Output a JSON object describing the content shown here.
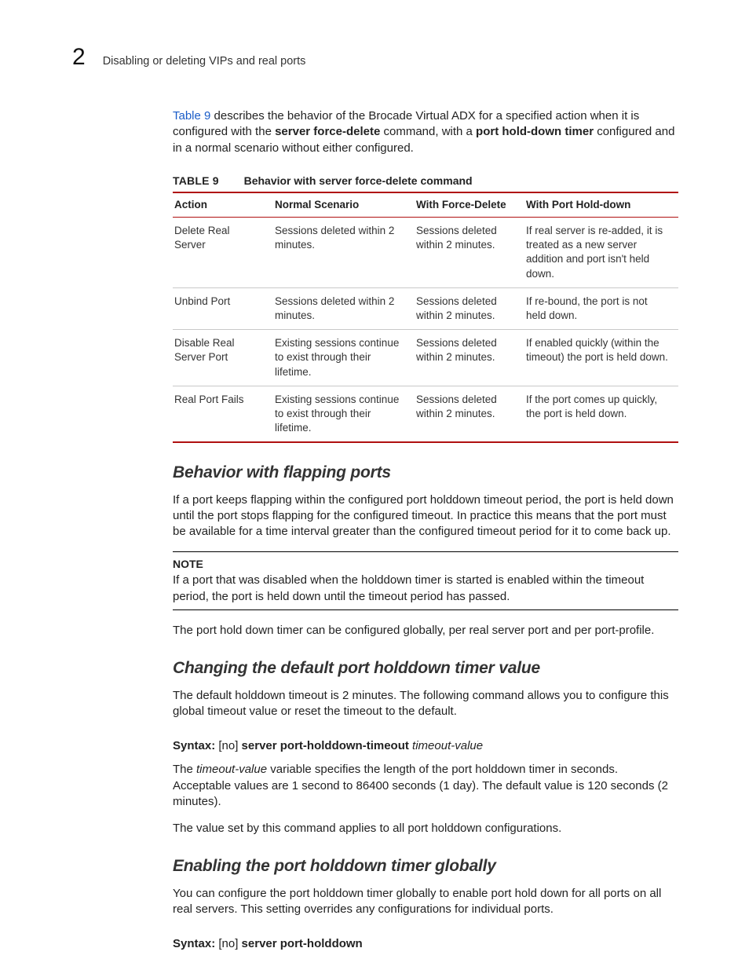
{
  "header": {
    "chapter_number": "2",
    "running_title": "Disabling or deleting VIPs and real ports"
  },
  "intro": {
    "link_text": "Table 9",
    "rest": " describes the behavior of the Brocade Virtual ADX for a specified action when it is configured with the ",
    "cmd1": "server force-delete",
    "mid": " command, with a ",
    "cmd2": "port hold-down timer",
    "tail": " configured and in a normal scenario without either configured."
  },
  "table": {
    "label": "TABLE 9",
    "title": "Behavior with server force-delete command",
    "headers": [
      "Action",
      "Normal Scenario",
      "With Force-Delete",
      "With Port Hold-down"
    ],
    "rows": [
      [
        "Delete Real Server",
        "Sessions deleted within 2 minutes.",
        "Sessions deleted within 2 minutes.",
        "If real server is re-added, it is treated as a new server addition and port isn't held down."
      ],
      [
        "Unbind Port",
        "Sessions deleted within 2 minutes.",
        "Sessions deleted within 2 minutes.",
        "If re-bound, the port is not held down."
      ],
      [
        "Disable Real Server Port",
        "Existing sessions continue to exist through their lifetime.",
        "Sessions deleted within 2 minutes.",
        "If enabled quickly (within the timeout) the port is held down."
      ],
      [
        "Real Port Fails",
        "Existing sessions continue to exist through their lifetime.",
        "Sessions deleted within 2 minutes.",
        "If the port comes up quickly, the port is held down."
      ]
    ]
  },
  "sections": {
    "flapping": {
      "heading": "Behavior with flapping ports",
      "para": "If a port keeps flapping within the configured port holddown timeout period, the port is held down until the port stops flapping for the configured timeout. In practice this means that the port must be available for a time interval greater than the configured timeout period for it to come back up.",
      "note_label": "NOTE",
      "note_text": "If a port that was disabled when the holddown timer is started is enabled within the timeout period, the port is held down until the timeout period has passed.",
      "after_note": "The port hold down timer can be configured globally, per real server port and per port-profile."
    },
    "changing": {
      "heading": "Changing the default port holddown timer value",
      "para": "The default holddown timeout is 2 minutes. The following command allows you to configure this global timeout value or reset the timeout to the default.",
      "syntax_label": "Syntax:  ",
      "syntax_no": "[no] ",
      "syntax_cmd": "server port-holddown-timeout ",
      "syntax_var": "timeout-value",
      "explain_pre": "The ",
      "explain_var": "timeout-value",
      "explain_post": " variable specifies the length of the port holddown timer in seconds. Acceptable values are 1 second to 86400 seconds (1 day). The default value is 120 seconds (2 minutes).",
      "applies": "The value set by this command applies to all port holddown configurations."
    },
    "enabling": {
      "heading": "Enabling the port holddown timer globally",
      "para": "You can configure the port holddown timer globally to enable port hold down for all ports on all real servers. This setting overrides any configurations for individual ports.",
      "syntax_label": "Syntax:  ",
      "syntax_no": "[no] ",
      "syntax_cmd": "server port-holddown"
    }
  }
}
